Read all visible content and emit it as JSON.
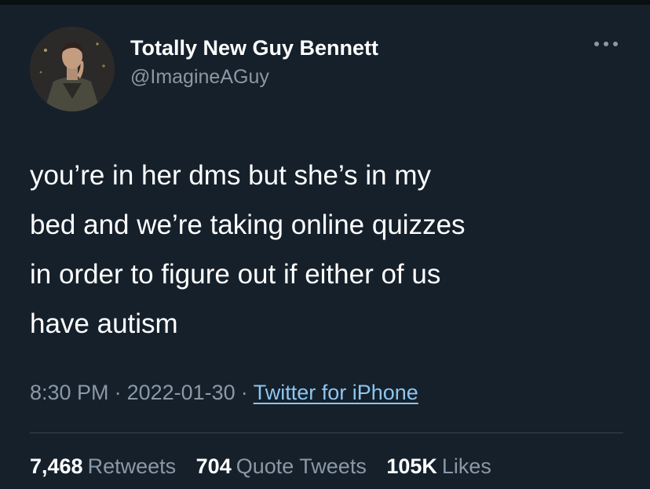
{
  "user": {
    "display_name": "Totally New Guy Bennett",
    "handle": "@ImagineAGuy"
  },
  "tweet": {
    "text": "you’re in her dms but she’s in my\nbed and we’re taking online quizzes\nin order to figure out if either of us\nhave autism",
    "time": "8:30 PM",
    "date": "2022-01-30",
    "separator": "·",
    "source": "Twitter for iPhone"
  },
  "stats": {
    "retweets_count": "7,468",
    "retweets_label": "Retweets",
    "quotes_count": "704",
    "quotes_label": "Quote Tweets",
    "likes_count": "105K",
    "likes_label": "Likes"
  },
  "icons": {
    "more": "more-horizontal-icon"
  },
  "colors": {
    "background": "#15202b",
    "text_primary": "#ffffff",
    "text_secondary": "#8b98a5",
    "link": "#8ec5ee",
    "divider": "#38444d"
  }
}
